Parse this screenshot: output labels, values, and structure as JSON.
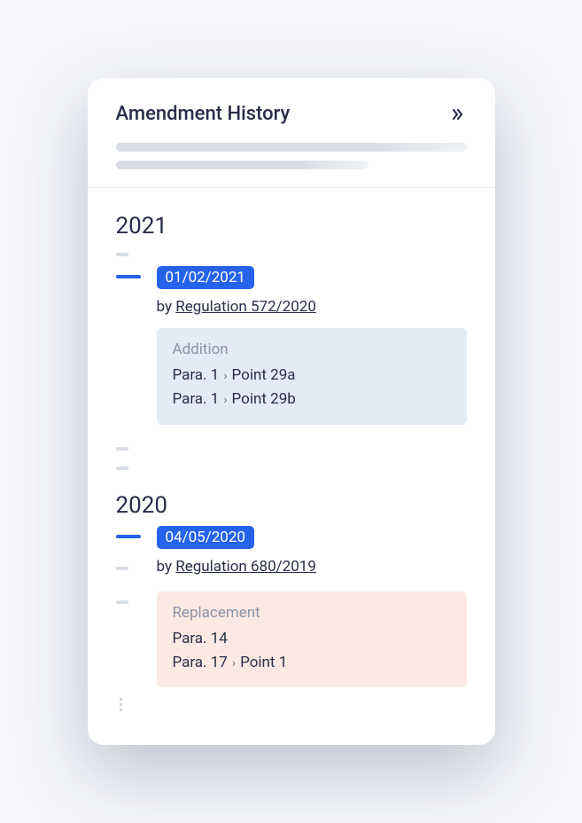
{
  "header": {
    "title": "Amendment History"
  },
  "years": {
    "y2021": {
      "label": "2021",
      "entry": {
        "date": "01/02/2021",
        "by_prefix": "by ",
        "regulation": "Regulation 572/2020",
        "change_type": "Addition",
        "items": {
          "i0": {
            "para": "Para. 1",
            "point": "Point 29a"
          },
          "i1": {
            "para": "Para. 1",
            "point": "Point 29b"
          }
        }
      }
    },
    "y2020": {
      "label": "2020",
      "entry": {
        "date": "04/05/2020",
        "by_prefix": "by ",
        "regulation": "Regulation 680/2019",
        "change_type": "Replacement",
        "items": {
          "i0": {
            "para": "Para. 14"
          },
          "i1": {
            "para": "Para. 17",
            "point": "Point 1"
          }
        }
      }
    }
  }
}
